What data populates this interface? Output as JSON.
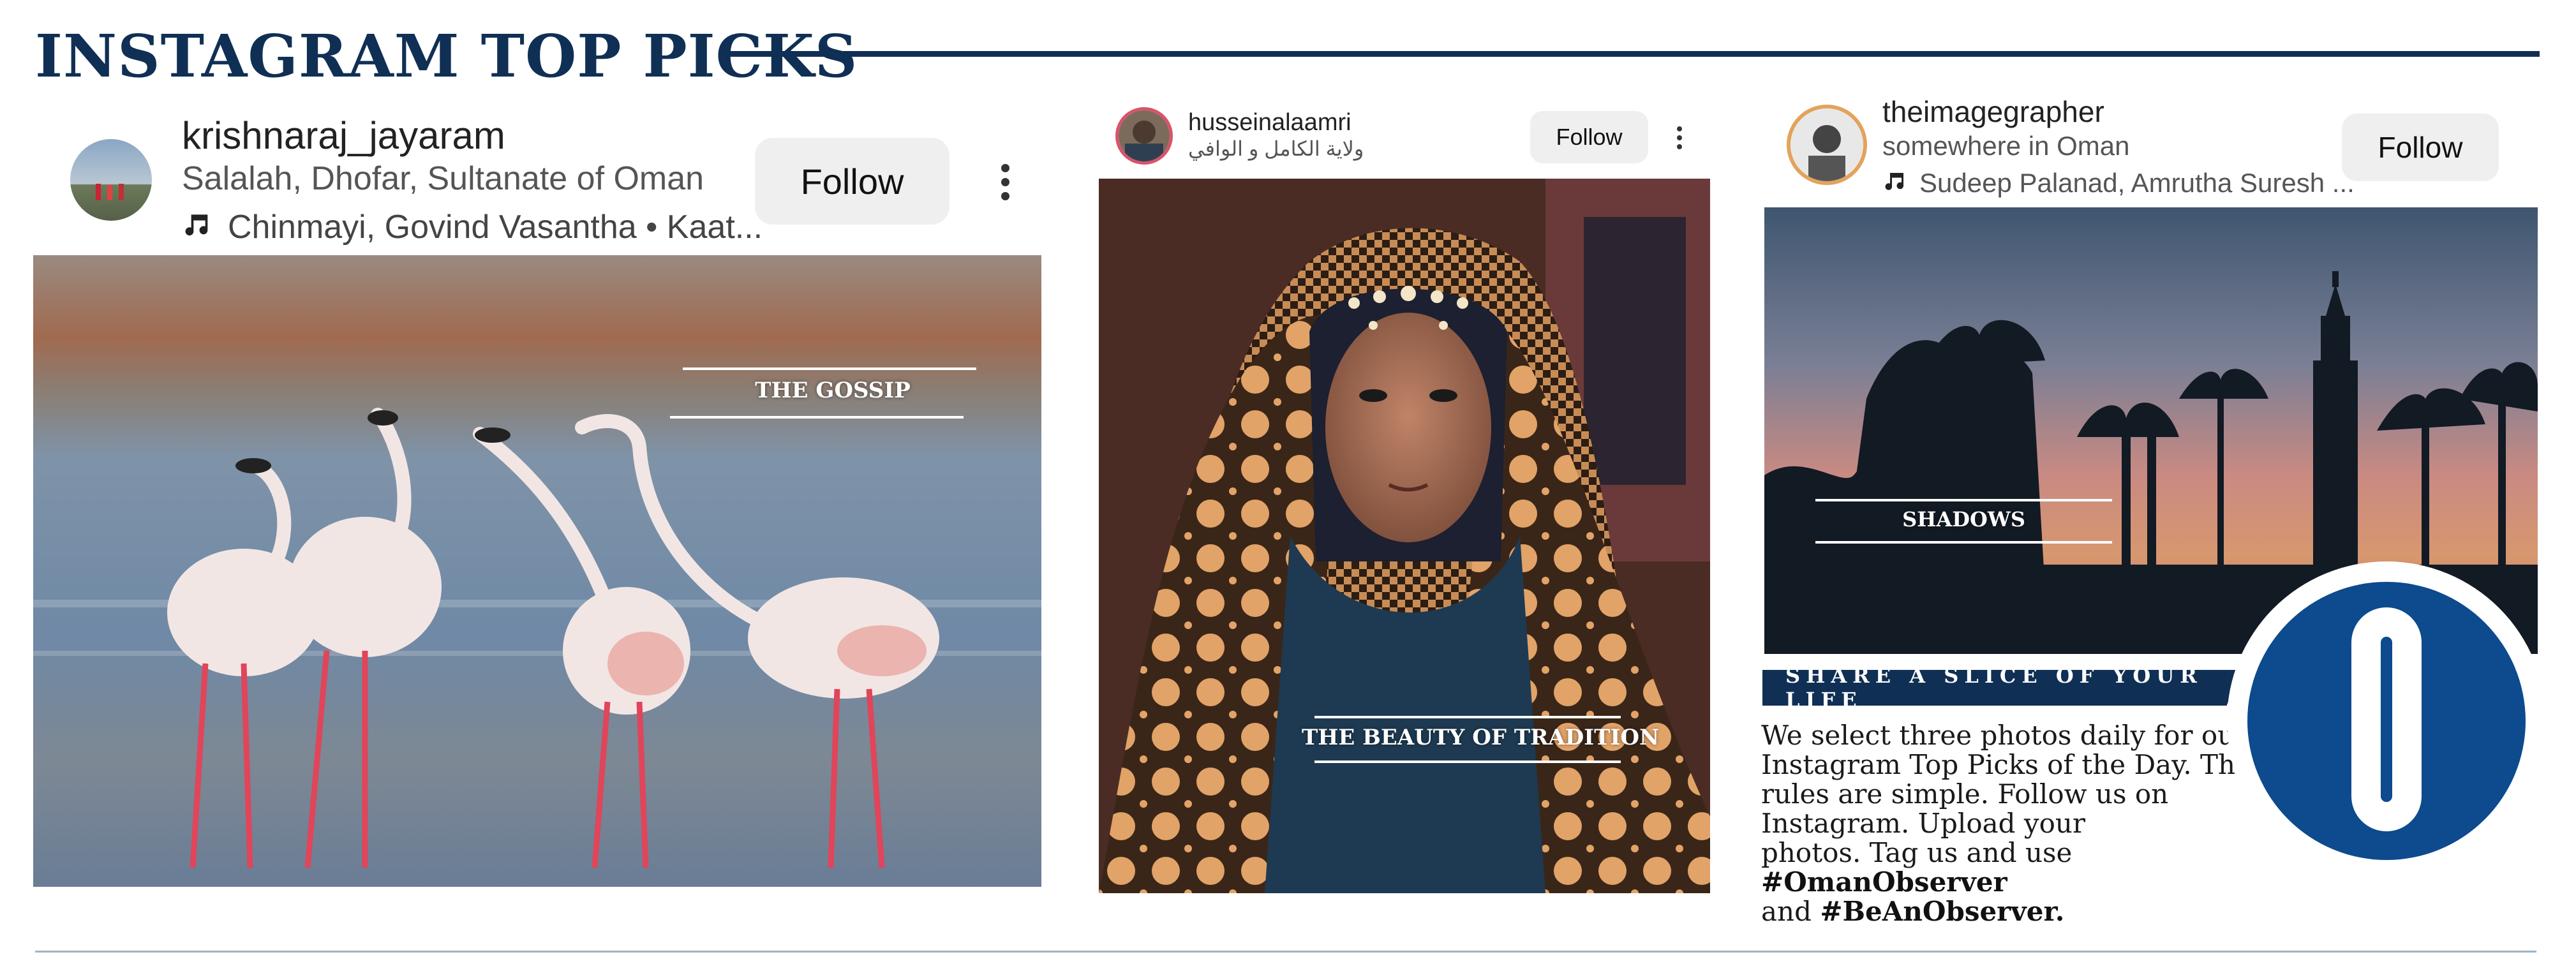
{
  "header": {
    "title": "INSTAGRAM TOP PICKS"
  },
  "colors": {
    "navy": "#102f54",
    "logo_blue": "#0d4a8e",
    "follow_bg": "#efefef"
  },
  "posts": [
    {
      "username": "krishnaraj_jayaram",
      "location": "Salalah, Dhofar, Sultanate of Oman",
      "music": "Chinmayi, Govind Vasantha • Kaat...",
      "music_icon": "music-note-icon",
      "follow_label": "Follow",
      "menu_icon": "more-vertical-icon",
      "caption": "THE GOSSIP",
      "photo_subject": "flamingos"
    },
    {
      "username": "husseinalaamri",
      "location": "ولاية الكامل و الوافي",
      "follow_label": "Follow",
      "menu_icon": "more-vertical-icon",
      "caption": "THE BEAUTY OF TRADITION",
      "photo_subject": "portrait"
    },
    {
      "username": "theimagegrapher",
      "location": "somewhere in Oman",
      "music": "Sudeep Palanad, Amrutha Suresh ...",
      "music_icon": "music-note-icon",
      "follow_label": "Follow",
      "caption": "SHADOWS",
      "photo_subject": "palm-silhouette"
    }
  ],
  "share": {
    "banner": "SHARE A SLICE OF YOUR LIFE",
    "body_lines": [
      "We select three photos daily for our",
      "Instagram Top Picks of the Day. The",
      "rules are simple. Follow us on",
      "Instagram. Upload your"
    ],
    "body_line5_prefix": "photos. Tag us and use ",
    "hashtag1": "#OmanObserver",
    "body_line6_prefix": "and ",
    "hashtag2": "#BeAnObserver."
  },
  "logo": {
    "letter": "O"
  }
}
